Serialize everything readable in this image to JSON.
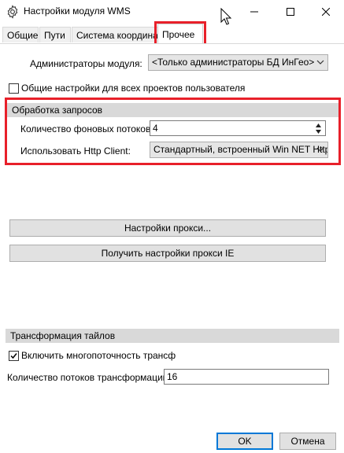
{
  "window": {
    "title": "Настройки модуля WMS"
  },
  "tabs": [
    {
      "label": "Общие"
    },
    {
      "label": "Пути"
    },
    {
      "label": "Система координат"
    },
    {
      "label": "Прочее"
    }
  ],
  "admins": {
    "label": "Администраторы модуля:",
    "value": "<Только администраторы БД ИнГео>"
  },
  "common_settings": {
    "label": "Общие настройки для всех проектов пользователя",
    "checked": false
  },
  "requests_group": {
    "title": "Обработка запросов",
    "threads_label": "Количество фоновых потоков:",
    "threads_value": "4",
    "http_label": "Использовать Http Client:",
    "http_value": "Стандартный, встроенный Win NET Http"
  },
  "buttons": {
    "proxy_settings": "Настройки прокси...",
    "get_ie_proxy": "Получить настройки прокси IE",
    "ok": "OK",
    "cancel": "Отмена"
  },
  "tiles_group": {
    "title": "Трансформация тайлов",
    "multithread_label": "Включить многопоточность трансформ",
    "multithread_checked": true,
    "threads_label": "Количество потоков трансформации:",
    "threads_value": "16"
  },
  "colors": {
    "highlight": "#e8202a",
    "group_bar": "#d9d9d9",
    "ok_border": "#0078d7"
  },
  "icons": [
    "gear-icon",
    "minimize-icon",
    "maximize-icon",
    "close-icon",
    "mouse-cursor-icon",
    "chevron-down-icon",
    "spin-up-icon",
    "spin-down-icon",
    "checkmark-icon"
  ]
}
